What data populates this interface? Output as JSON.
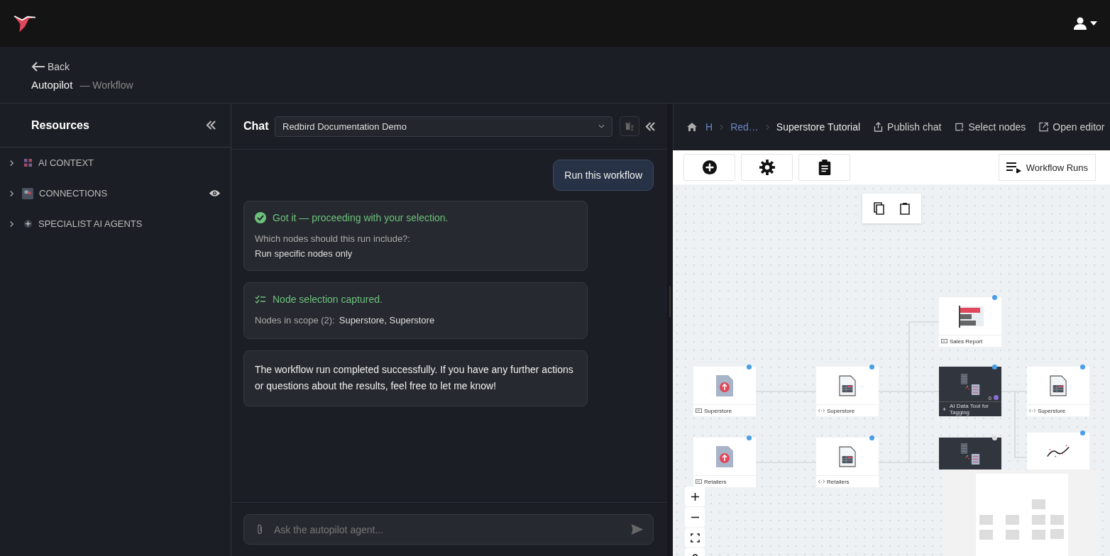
{
  "header": {
    "back": "Back",
    "title": "Autopilot",
    "subtitle": "— Workflow"
  },
  "resources": {
    "title": "Resources",
    "items": [
      {
        "label": "AI CONTEXT",
        "kind": "context",
        "expanded": false,
        "eye": false
      },
      {
        "label": "CONNECTIONS",
        "kind": "connections",
        "expanded": false,
        "eye": true
      },
      {
        "label": "SPECIALIST AI AGENTS",
        "kind": "agents",
        "expanded": false,
        "eye": false
      }
    ]
  },
  "chat": {
    "title": "Chat",
    "session": "Redbird Documentation Demo",
    "messages": [
      {
        "kind": "user",
        "text": "Run this workflow"
      },
      {
        "kind": "confirm",
        "title": "Got it — proceeding with your selection.",
        "question": "Which nodes should this run include?:",
        "answer": "Run specific nodes only"
      },
      {
        "kind": "selection",
        "title": "Node selection captured.",
        "label": "Nodes in scope (2):",
        "value": "Superstore, Superstore"
      },
      {
        "kind": "text",
        "text": "The workflow run completed successfully. If you have any further actions or questions about the results, feel free to let me know!"
      }
    ],
    "input": {
      "placeholder": "Ask the autopilot agent..."
    }
  },
  "workflow": {
    "breadcrumb": [
      {
        "label": "H",
        "link": true
      },
      {
        "label": "Red…",
        "link": true
      },
      {
        "label": "Superstore Tutorial",
        "link": false
      }
    ],
    "actions": [
      {
        "kind": "publish",
        "label": "Publish chat"
      },
      {
        "kind": "select",
        "label": "Select nodes"
      },
      {
        "kind": "open",
        "label": "Open editor"
      }
    ],
    "runs_button": "Workflow Runs",
    "nodes": [
      {
        "kind": "upload",
        "label": "Superstore",
        "done": true
      },
      {
        "kind": "table",
        "label": "Superstore",
        "done": true
      },
      {
        "kind": "report",
        "label": "Sales Report",
        "done": true
      },
      {
        "kind": "ai",
        "label": "AI Data Tool for Tagging",
        "counter": "0",
        "done": true
      },
      {
        "kind": "table",
        "label": "Superstore",
        "done": true
      },
      {
        "kind": "upload",
        "label": "Retailers",
        "done": true
      },
      {
        "kind": "table",
        "label": "Retailers",
        "done": true
      },
      {
        "kind": "ai",
        "done": false
      },
      {
        "kind": "chart",
        "done": true
      }
    ]
  }
}
